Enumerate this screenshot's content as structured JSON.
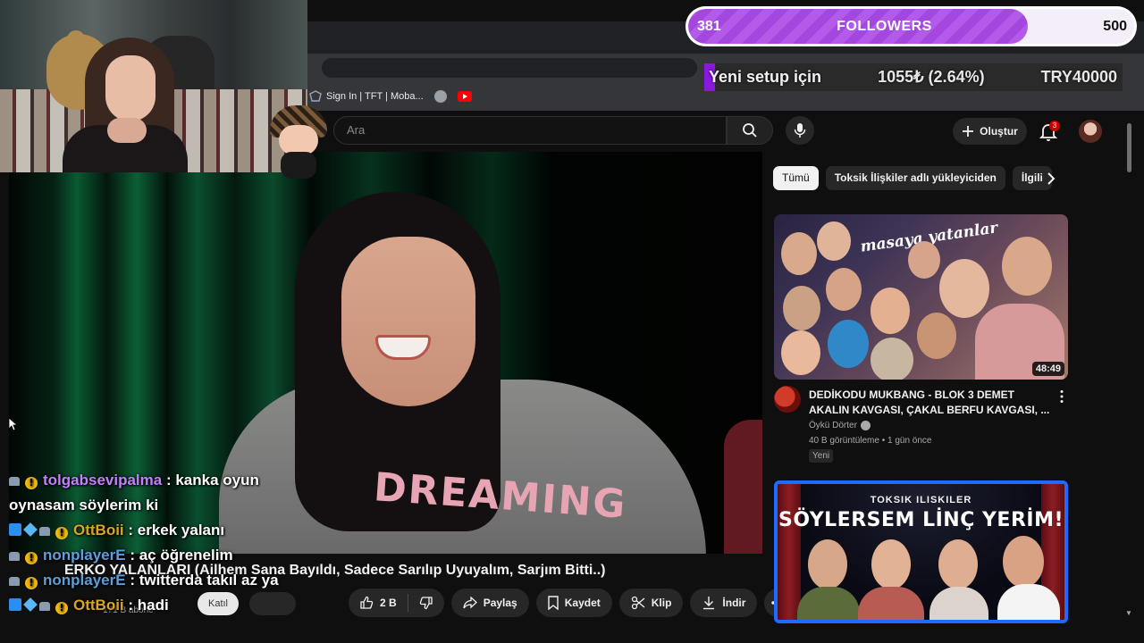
{
  "browser": {
    "bookmarks": [
      {
        "label": "Sign In | TFT | Moba..."
      },
      {
        "label": ""
      },
      {
        "label": ""
      }
    ],
    "window_controls": [
      "—",
      "▢",
      "✕"
    ]
  },
  "youtube": {
    "search": {
      "placeholder": "Ara"
    },
    "create_label": "Oluştur",
    "notification_count": "3"
  },
  "video": {
    "title": "ERKO YALANLARI (Ailhem Sana Bayıldı, Sadece Sarılıp Uyuyalım, Sarjım Bitti..)",
    "sweater_text": "DREAMING",
    "channel_subscribers": "171 B abone",
    "join_label": "Katıl",
    "actions": {
      "like_count": "2 B",
      "share": "Paylaş",
      "save": "Kaydet",
      "clip": "Klip",
      "download": "İndir"
    }
  },
  "recommendations": {
    "chips": [
      "Tümü",
      "Toksik İlişkiler adlı yükleyiciden",
      "İlgili"
    ],
    "items": [
      {
        "thumb_brand": "masaya yatanlar",
        "duration": "48:49",
        "title_line1": "DEDİKODU MUKBANG - BLOK 3 DEMET",
        "title_line2": "AKALIN KAVGASI, ÇAKAL BERFU KAVGASI, ...",
        "channel": "Öykü Dörter",
        "meta": "40 B görüntüleme • 1 gün önce",
        "badge": "Yeni"
      },
      {
        "thumb_top": "TOKSIK ILISKILER",
        "thumb_main": "SÖYLERSEM LİNÇ YERİM!"
      }
    ]
  },
  "stream_overlay": {
    "followers_goal": {
      "current": "381",
      "label": "FOLLOWERS",
      "target": "500",
      "progress_fraction": 0.762
    },
    "donation_goal": {
      "title": "Yeni setup için",
      "progress": "1055₺ (2.64%)",
      "target": "TRY40000",
      "progress_fraction": 0.0264
    },
    "chat": [
      {
        "badges": [
          "mod",
          "gold"
        ],
        "user": "tolgabsevipalma",
        "user_color": "#c77dff",
        "message": " : kanka oyun"
      },
      {
        "badges": [],
        "user": "",
        "user_color": "#ffffff",
        "message": "oynasam söylerim ki"
      },
      {
        "badges": [
          "pin",
          "cube",
          "mod",
          "gold"
        ],
        "user": "OttBoii",
        "user_color": "#daa520",
        "message": " : erkek yalanı"
      },
      {
        "badges": [
          "mod",
          "gold"
        ],
        "user": "nonplayerE",
        "user_color": "#5f9ed8",
        "message": " : aç öğrenelim"
      },
      {
        "badges": [
          "mod",
          "gold"
        ],
        "user": "nonplayerE",
        "user_color": "#5f9ed8",
        "message": " : twitterda takıl az ya"
      },
      {
        "badges": [
          "pin",
          "cube",
          "mod",
          "gold"
        ],
        "user": "OttBoii",
        "user_color": "#daa520",
        "message": " : hadi"
      }
    ]
  },
  "colors": {
    "goal_fill": "#b45ae8",
    "donation_fill": "#8a18e0",
    "active_tab_border": "#1f6bff",
    "notification_badge": "#cc0000"
  }
}
